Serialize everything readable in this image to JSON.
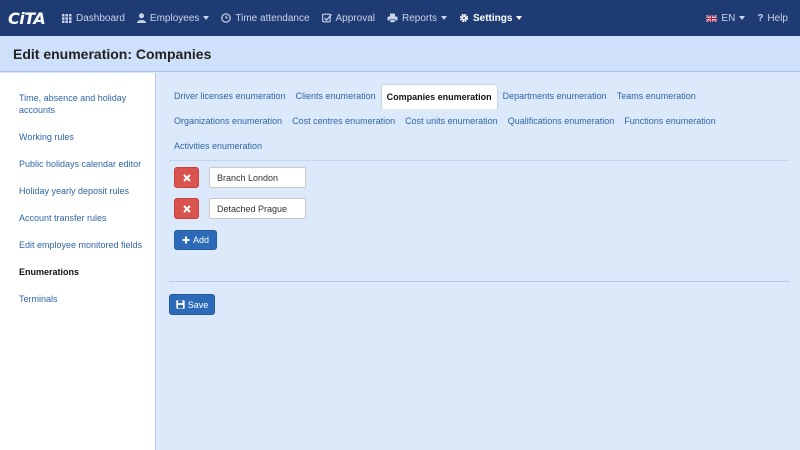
{
  "logo": "CiTA",
  "nav": {
    "dashboard": "Dashboard",
    "employees": "Employees",
    "time_attendance": "Time attendance",
    "approval": "Approval",
    "reports": "Reports",
    "settings": "Settings",
    "language": "EN",
    "help": "Help"
  },
  "page_title": "Edit enumeration: Companies",
  "sidebar": {
    "items": [
      {
        "label": "Time, absence and holiday accounts"
      },
      {
        "label": "Working rules"
      },
      {
        "label": "Public holidays calendar editor"
      },
      {
        "label": "Holiday yearly deposit rules"
      },
      {
        "label": "Account transfer rules"
      },
      {
        "label": "Edit employee monitored fields"
      },
      {
        "label": "Enumerations"
      },
      {
        "label": "Terminals"
      }
    ]
  },
  "tabs": {
    "row1": [
      "Driver licenses enumeration",
      "Clients enumeration",
      "Companies enumeration",
      "Departments enumeration",
      "Teams enumeration"
    ],
    "row2": [
      "Organizations enumeration",
      "Cost centres enumeration",
      "Cost units enumeration",
      "Qualifications enumeration",
      "Functions enumeration"
    ],
    "row3": [
      "Activities enumeration"
    ]
  },
  "entries": [
    {
      "value": "Branch London"
    },
    {
      "value": "Detached Prague"
    }
  ],
  "add_label": "Add",
  "save_label": "Save",
  "colors": {
    "navbar": "#1f3b73",
    "delete": "#d9534f",
    "primary": "#2d6bb9",
    "link": "#2f66a8"
  }
}
